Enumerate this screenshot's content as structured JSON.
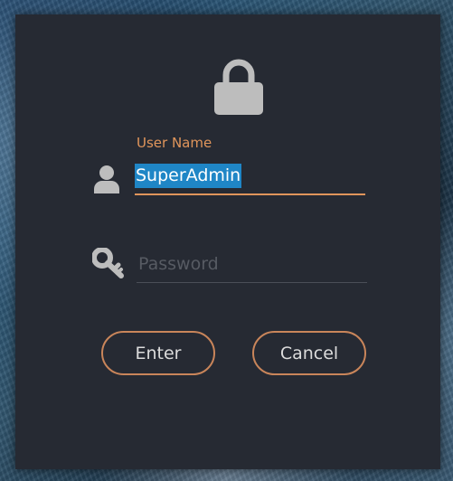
{
  "dialog": {
    "username_label": "User Name",
    "username_value": "SuperAdmin",
    "password_placeholder": "Password",
    "enter_label": "Enter",
    "cancel_label": "Cancel"
  },
  "icons": {
    "header": "lock-icon",
    "username": "user-icon",
    "password": "key-icon"
  },
  "colors": {
    "panel_background": "#262a33",
    "accent": "#e0955b",
    "button_border": "#c9855a",
    "selection_highlight": "#1f86c6",
    "icon_gray": "#bdbdbd"
  }
}
